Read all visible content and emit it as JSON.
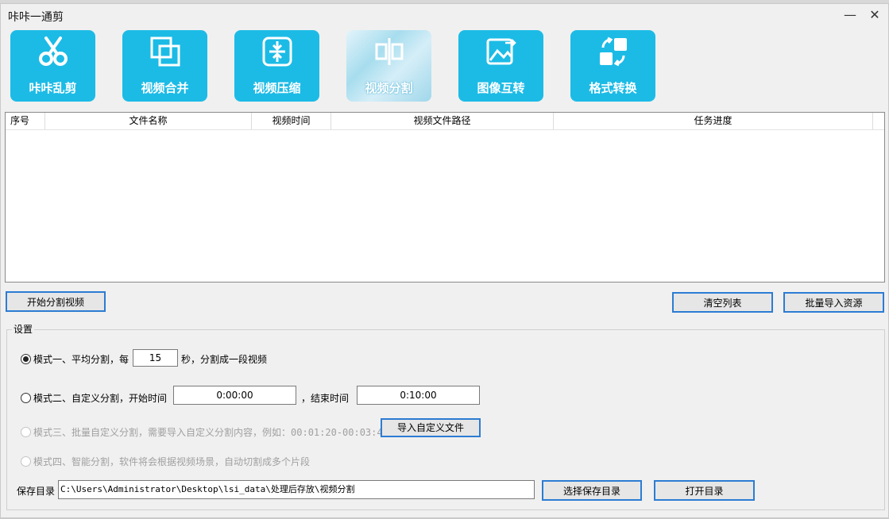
{
  "window": {
    "title": "咔咔一通剪",
    "minimize": "—",
    "close": "✕"
  },
  "toolbar": [
    {
      "label": "咔咔乱剪",
      "icon": "scissors-icon"
    },
    {
      "label": "视频合并",
      "icon": "merge-icon"
    },
    {
      "label": "视频压缩",
      "icon": "compress-icon"
    },
    {
      "label": "视频分割",
      "icon": "split-icon",
      "active": true
    },
    {
      "label": "图像互转",
      "icon": "image-convert-icon"
    },
    {
      "label": "格式转换",
      "icon": "format-convert-icon"
    }
  ],
  "table": {
    "columns": [
      "序号",
      "文件名称",
      "视频时间",
      "视频文件路径",
      "任务进度"
    ],
    "rows": []
  },
  "actions": {
    "start": "开始分割视频",
    "clear": "清空列表",
    "import": "批量导入资源"
  },
  "settings": {
    "group_label": "设置",
    "mode1": {
      "label_a": "模式一、平均分割，每",
      "seconds": "15",
      "label_b": "秒，分割成一段视频"
    },
    "mode2": {
      "label_a": "模式二、自定义分割，开始时间",
      "start": "0:00:00",
      "label_b": "，结束时间",
      "end": "0:10:00"
    },
    "mode3": {
      "label": "模式三、批量自定义分割，需要导入自定义分割内容，例如：",
      "example": "00:01:20-00:03:40",
      "button": "导入自定义文件"
    },
    "mode4": {
      "label": "模式四、智能分割，软件将会根据视频场景，自动切割成多个片段"
    },
    "save": {
      "label": "保存目录",
      "path": "C:\\Users\\Administrator\\Desktop\\lsi_data\\处理后存放\\视频分割",
      "choose": "选择保存目录",
      "open": "打开目录"
    }
  },
  "colors": {
    "accent": "#1cbbe6",
    "button_border": "#2c7cd3"
  }
}
